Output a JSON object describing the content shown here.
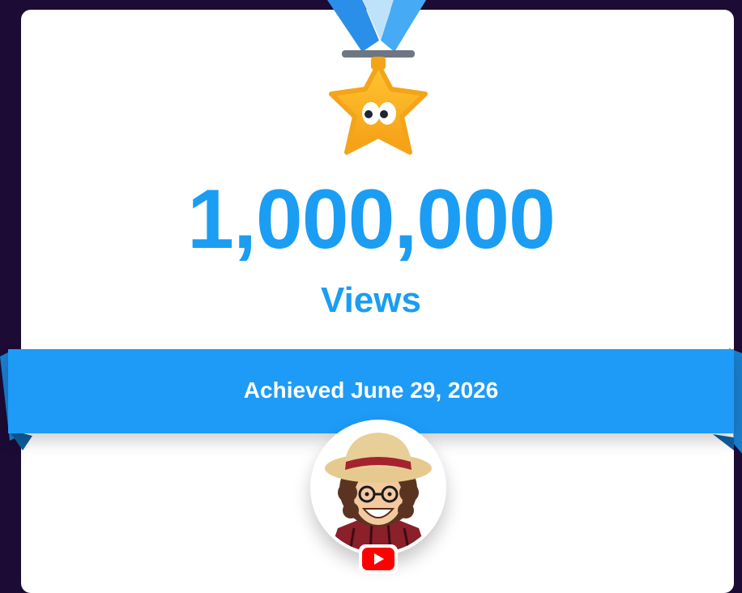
{
  "milestone": {
    "count": "1,000,000",
    "metric": "Views",
    "achieved_text": "Achieved June 29, 2026"
  },
  "icons": {
    "medal": "star-medal-icon",
    "avatar": "channel-avatar",
    "platform": "youtube-icon"
  },
  "colors": {
    "background": "#1c0b35",
    "accent_blue": "#1b9df3",
    "banner_blue": "#1e9bf6",
    "medal_gold": "#f9b21c",
    "youtube_red": "#ff0000"
  }
}
